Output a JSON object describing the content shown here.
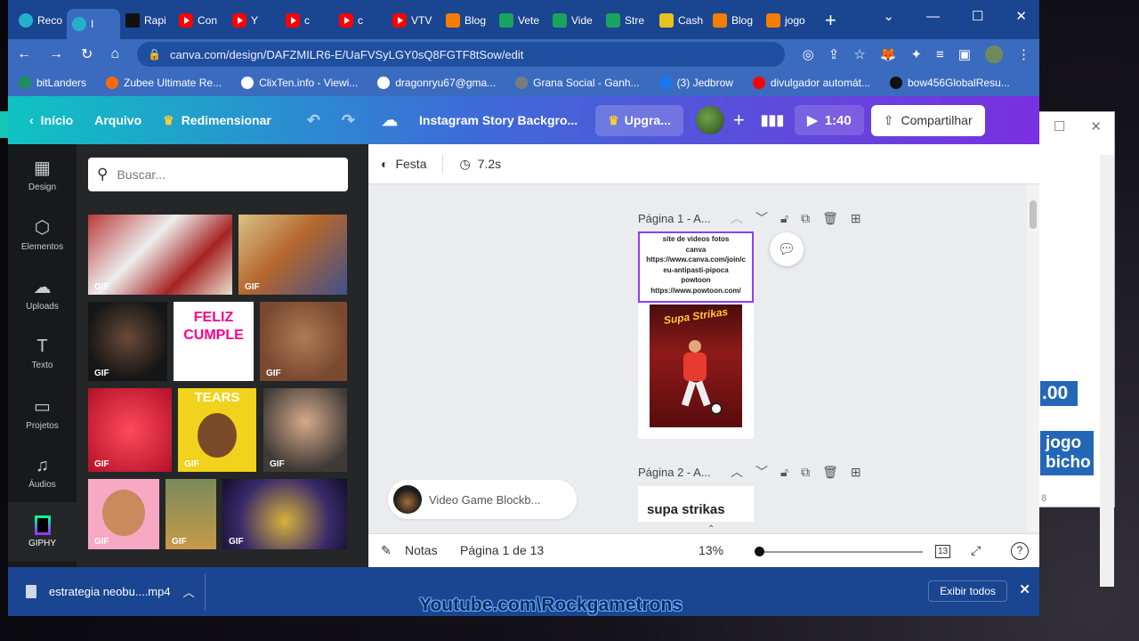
{
  "browser": {
    "tabs": [
      {
        "label": "Reco",
        "icon": "canva-favicon",
        "active": false
      },
      {
        "label": "I",
        "icon": "canva-favicon",
        "active": true
      },
      {
        "label": "Rapi",
        "icon": "r-favicon",
        "active": false
      },
      {
        "label": "Con",
        "icon": "youtube-favicon",
        "active": false
      },
      {
        "label": "Y",
        "icon": "youtube-favicon",
        "active": false
      },
      {
        "label": "c",
        "icon": "youtube-favicon",
        "active": false
      },
      {
        "label": "c",
        "icon": "youtube-favicon",
        "active": false
      },
      {
        "label": "VTV",
        "icon": "youtube-favicon",
        "active": false
      },
      {
        "label": "Blog",
        "icon": "blogger-favicon",
        "active": false
      },
      {
        "label": "Vete",
        "icon": "clover-favicon",
        "active": false
      },
      {
        "label": "Vide",
        "icon": "clover-favicon",
        "active": false
      },
      {
        "label": "Stre",
        "icon": "clover-favicon",
        "active": false
      },
      {
        "label": "Cash",
        "icon": "cash-favicon",
        "active": false
      },
      {
        "label": "Blog",
        "icon": "blogger-favicon",
        "active": false
      },
      {
        "label": "jogo",
        "icon": "blogger-favicon",
        "active": false
      }
    ],
    "new_tab": "+",
    "url": "canva.com/design/DAFZMILR6-E/UaFVSyLGY0sQ8FGTF8tSow/edit",
    "bookmarks": [
      {
        "label": "bitLanders"
      },
      {
        "label": "Zubee Ultimate Re..."
      },
      {
        "label": "ClixTen.info - Viewi..."
      },
      {
        "label": "dragonryu67@gma..."
      },
      {
        "label": "Grana Social - Ganh..."
      },
      {
        "label": "(3) Jedbrow"
      },
      {
        "label": "divulgador automát..."
      },
      {
        "label": "bow456GlobalResu..."
      }
    ]
  },
  "canva_header": {
    "back": "Início",
    "file": "Arquivo",
    "resize": "Redimensionar",
    "doc_title": "Instagram Story Backgro...",
    "upgrade": "Upgra...",
    "timer": "1:40",
    "share": "Compartilhar"
  },
  "rail": [
    {
      "label": "Design",
      "icon": "design-icon"
    },
    {
      "label": "Elementos",
      "icon": "elements-icon"
    },
    {
      "label": "Uploads",
      "icon": "upload-icon"
    },
    {
      "label": "Texto",
      "icon": "text-icon"
    },
    {
      "label": "Projetos",
      "icon": "folder-icon"
    },
    {
      "label": "Áudios",
      "icon": "music-icon"
    },
    {
      "label": "GIPHY",
      "icon": "giphy-icon"
    }
  ],
  "panel": {
    "search_placeholder": "Buscar...",
    "gif_tag": "GIF",
    "tears_text": "TEARS",
    "feliz_text": "FELIZ CUMPLE"
  },
  "editor": {
    "toolbar": {
      "animation": "Festa",
      "duration": "7.2s"
    },
    "page1_label": "Página 1 - A...",
    "page1_text": [
      "site de videos fotos",
      "canva",
      "https://www.canva.com/join/c",
      "eu-antipasti-pipoca",
      "powtoon",
      "https://www.powtoon.com/"
    ],
    "poster_title": "Supa Strikas",
    "page2_label": "Página 2 - A...",
    "page2_text": "supa strikas",
    "audio_track": "Video Game Blockb...",
    "bottom": {
      "notes": "Notas",
      "page_counter": "Página 1 de 13",
      "zoom": "13%",
      "grid_count": "13",
      "help": "?"
    },
    "zoom_level": 0.0
  },
  "download_bar": {
    "file": "estrategia neobu....mp4",
    "show_all": "Exibir todos"
  },
  "background_window": {
    "price": ".00",
    "jogo": "jogo bicho",
    "number": "8"
  },
  "watermark": "Youtube.com\\Rockgametrons"
}
